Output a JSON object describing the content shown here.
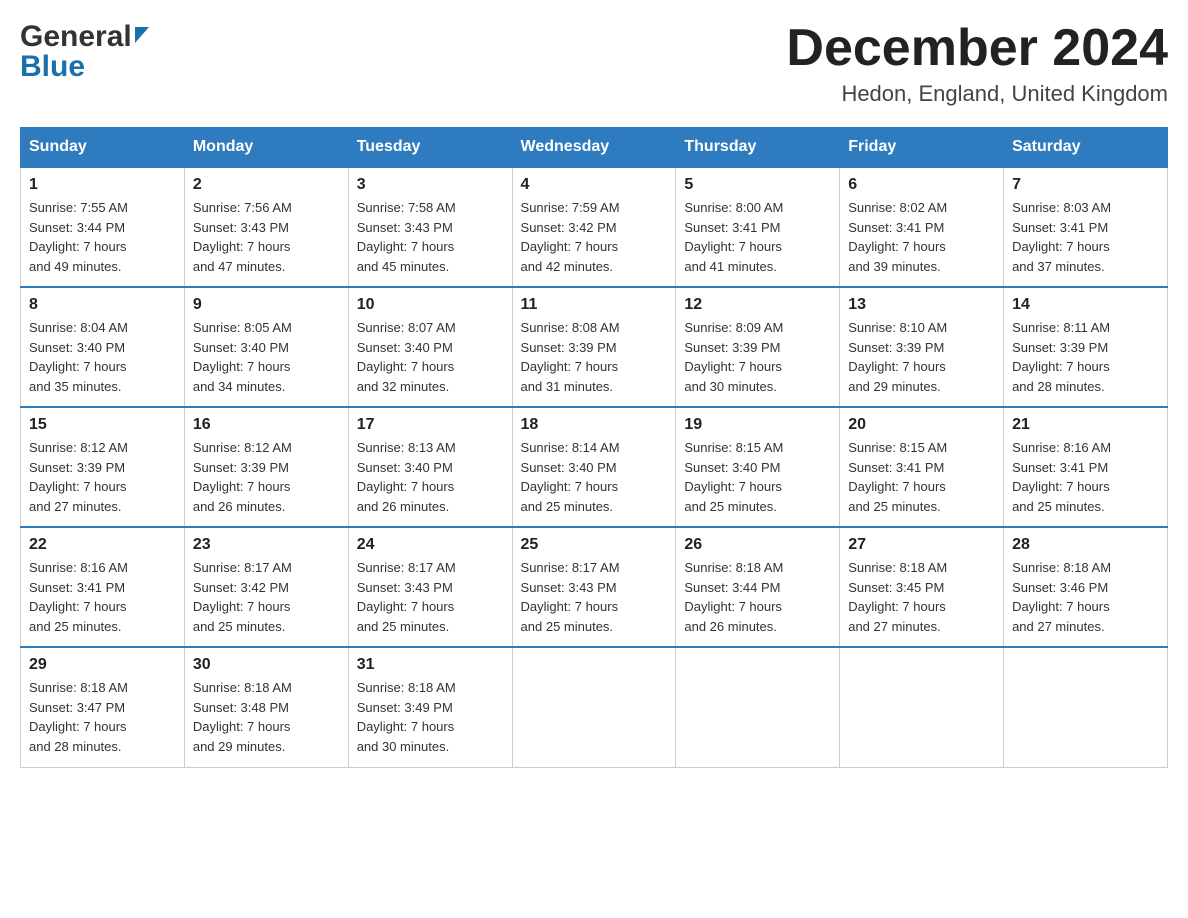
{
  "header": {
    "logo_general": "General",
    "logo_blue": "Blue",
    "title": "December 2024",
    "location": "Hedon, England, United Kingdom"
  },
  "columns": [
    "Sunday",
    "Monday",
    "Tuesday",
    "Wednesday",
    "Thursday",
    "Friday",
    "Saturday"
  ],
  "weeks": [
    [
      {
        "day": "1",
        "sunrise": "Sunrise: 7:55 AM",
        "sunset": "Sunset: 3:44 PM",
        "daylight": "Daylight: 7 hours",
        "daylight2": "and 49 minutes."
      },
      {
        "day": "2",
        "sunrise": "Sunrise: 7:56 AM",
        "sunset": "Sunset: 3:43 PM",
        "daylight": "Daylight: 7 hours",
        "daylight2": "and 47 minutes."
      },
      {
        "day": "3",
        "sunrise": "Sunrise: 7:58 AM",
        "sunset": "Sunset: 3:43 PM",
        "daylight": "Daylight: 7 hours",
        "daylight2": "and 45 minutes."
      },
      {
        "day": "4",
        "sunrise": "Sunrise: 7:59 AM",
        "sunset": "Sunset: 3:42 PM",
        "daylight": "Daylight: 7 hours",
        "daylight2": "and 42 minutes."
      },
      {
        "day": "5",
        "sunrise": "Sunrise: 8:00 AM",
        "sunset": "Sunset: 3:41 PM",
        "daylight": "Daylight: 7 hours",
        "daylight2": "and 41 minutes."
      },
      {
        "day": "6",
        "sunrise": "Sunrise: 8:02 AM",
        "sunset": "Sunset: 3:41 PM",
        "daylight": "Daylight: 7 hours",
        "daylight2": "and 39 minutes."
      },
      {
        "day": "7",
        "sunrise": "Sunrise: 8:03 AM",
        "sunset": "Sunset: 3:41 PM",
        "daylight": "Daylight: 7 hours",
        "daylight2": "and 37 minutes."
      }
    ],
    [
      {
        "day": "8",
        "sunrise": "Sunrise: 8:04 AM",
        "sunset": "Sunset: 3:40 PM",
        "daylight": "Daylight: 7 hours",
        "daylight2": "and 35 minutes."
      },
      {
        "day": "9",
        "sunrise": "Sunrise: 8:05 AM",
        "sunset": "Sunset: 3:40 PM",
        "daylight": "Daylight: 7 hours",
        "daylight2": "and 34 minutes."
      },
      {
        "day": "10",
        "sunrise": "Sunrise: 8:07 AM",
        "sunset": "Sunset: 3:40 PM",
        "daylight": "Daylight: 7 hours",
        "daylight2": "and 32 minutes."
      },
      {
        "day": "11",
        "sunrise": "Sunrise: 8:08 AM",
        "sunset": "Sunset: 3:39 PM",
        "daylight": "Daylight: 7 hours",
        "daylight2": "and 31 minutes."
      },
      {
        "day": "12",
        "sunrise": "Sunrise: 8:09 AM",
        "sunset": "Sunset: 3:39 PM",
        "daylight": "Daylight: 7 hours",
        "daylight2": "and 30 minutes."
      },
      {
        "day": "13",
        "sunrise": "Sunrise: 8:10 AM",
        "sunset": "Sunset: 3:39 PM",
        "daylight": "Daylight: 7 hours",
        "daylight2": "and 29 minutes."
      },
      {
        "day": "14",
        "sunrise": "Sunrise: 8:11 AM",
        "sunset": "Sunset: 3:39 PM",
        "daylight": "Daylight: 7 hours",
        "daylight2": "and 28 minutes."
      }
    ],
    [
      {
        "day": "15",
        "sunrise": "Sunrise: 8:12 AM",
        "sunset": "Sunset: 3:39 PM",
        "daylight": "Daylight: 7 hours",
        "daylight2": "and 27 minutes."
      },
      {
        "day": "16",
        "sunrise": "Sunrise: 8:12 AM",
        "sunset": "Sunset: 3:39 PM",
        "daylight": "Daylight: 7 hours",
        "daylight2": "and 26 minutes."
      },
      {
        "day": "17",
        "sunrise": "Sunrise: 8:13 AM",
        "sunset": "Sunset: 3:40 PM",
        "daylight": "Daylight: 7 hours",
        "daylight2": "and 26 minutes."
      },
      {
        "day": "18",
        "sunrise": "Sunrise: 8:14 AM",
        "sunset": "Sunset: 3:40 PM",
        "daylight": "Daylight: 7 hours",
        "daylight2": "and 25 minutes."
      },
      {
        "day": "19",
        "sunrise": "Sunrise: 8:15 AM",
        "sunset": "Sunset: 3:40 PM",
        "daylight": "Daylight: 7 hours",
        "daylight2": "and 25 minutes."
      },
      {
        "day": "20",
        "sunrise": "Sunrise: 8:15 AM",
        "sunset": "Sunset: 3:41 PM",
        "daylight": "Daylight: 7 hours",
        "daylight2": "and 25 minutes."
      },
      {
        "day": "21",
        "sunrise": "Sunrise: 8:16 AM",
        "sunset": "Sunset: 3:41 PM",
        "daylight": "Daylight: 7 hours",
        "daylight2": "and 25 minutes."
      }
    ],
    [
      {
        "day": "22",
        "sunrise": "Sunrise: 8:16 AM",
        "sunset": "Sunset: 3:41 PM",
        "daylight": "Daylight: 7 hours",
        "daylight2": "and 25 minutes."
      },
      {
        "day": "23",
        "sunrise": "Sunrise: 8:17 AM",
        "sunset": "Sunset: 3:42 PM",
        "daylight": "Daylight: 7 hours",
        "daylight2": "and 25 minutes."
      },
      {
        "day": "24",
        "sunrise": "Sunrise: 8:17 AM",
        "sunset": "Sunset: 3:43 PM",
        "daylight": "Daylight: 7 hours",
        "daylight2": "and 25 minutes."
      },
      {
        "day": "25",
        "sunrise": "Sunrise: 8:17 AM",
        "sunset": "Sunset: 3:43 PM",
        "daylight": "Daylight: 7 hours",
        "daylight2": "and 25 minutes."
      },
      {
        "day": "26",
        "sunrise": "Sunrise: 8:18 AM",
        "sunset": "Sunset: 3:44 PM",
        "daylight": "Daylight: 7 hours",
        "daylight2": "and 26 minutes."
      },
      {
        "day": "27",
        "sunrise": "Sunrise: 8:18 AM",
        "sunset": "Sunset: 3:45 PM",
        "daylight": "Daylight: 7 hours",
        "daylight2": "and 27 minutes."
      },
      {
        "day": "28",
        "sunrise": "Sunrise: 8:18 AM",
        "sunset": "Sunset: 3:46 PM",
        "daylight": "Daylight: 7 hours",
        "daylight2": "and 27 minutes."
      }
    ],
    [
      {
        "day": "29",
        "sunrise": "Sunrise: 8:18 AM",
        "sunset": "Sunset: 3:47 PM",
        "daylight": "Daylight: 7 hours",
        "daylight2": "and 28 minutes."
      },
      {
        "day": "30",
        "sunrise": "Sunrise: 8:18 AM",
        "sunset": "Sunset: 3:48 PM",
        "daylight": "Daylight: 7 hours",
        "daylight2": "and 29 minutes."
      },
      {
        "day": "31",
        "sunrise": "Sunrise: 8:18 AM",
        "sunset": "Sunset: 3:49 PM",
        "daylight": "Daylight: 7 hours",
        "daylight2": "and 30 minutes."
      },
      null,
      null,
      null,
      null
    ]
  ]
}
